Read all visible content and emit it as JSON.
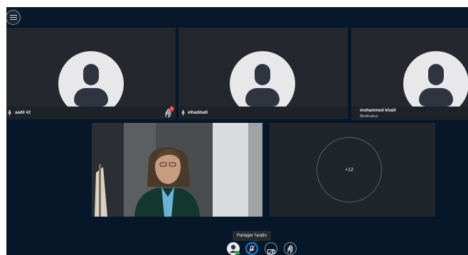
{
  "participants": [
    {
      "name": "aadil #2",
      "role": ""
    },
    {
      "name": "elhaddadi",
      "role": ""
    },
    {
      "name": "mohammed khalil",
      "role": "Modérateur"
    }
  ],
  "notification": {
    "count": "1"
  },
  "overflow": {
    "count_label": "+12"
  },
  "controls": {
    "audio_tooltip": "Partager l'audio"
  },
  "colors": {
    "background": "#06172a",
    "tile": "#24282e",
    "accent": "#1b7fdc",
    "alert": "#e4333c"
  },
  "icons": [
    "menu-icon",
    "user-icon",
    "microphone-icon",
    "mic-muted-icon",
    "hand-raise-icon",
    "camera-off-icon",
    "screen-share-icon"
  ]
}
